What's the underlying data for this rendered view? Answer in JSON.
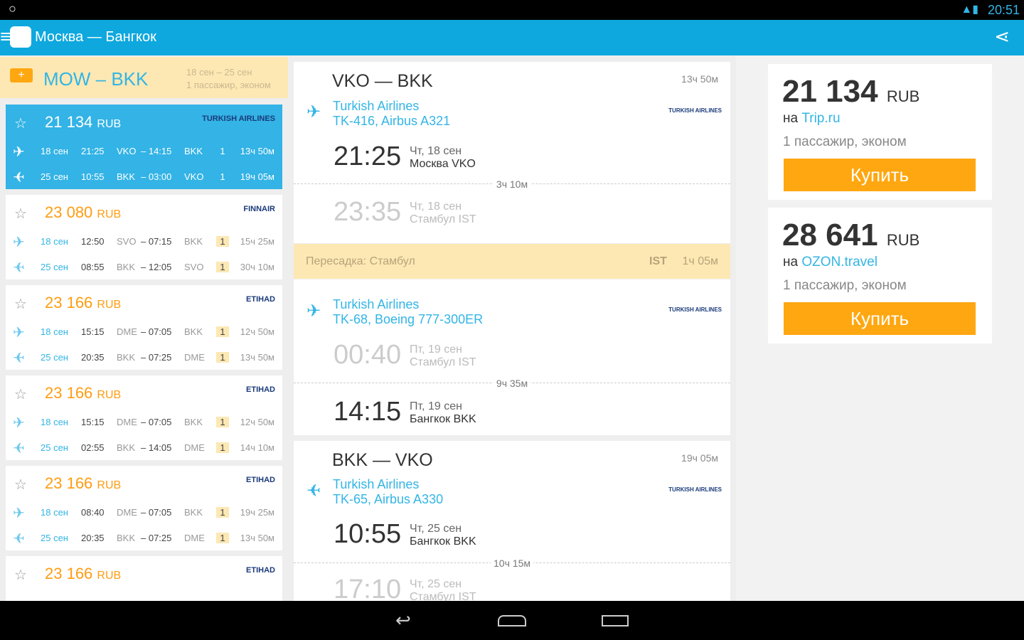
{
  "status": {
    "time": "20:51"
  },
  "appbar": {
    "title": "Москва — Бангкок",
    "icons": [
      "menu-icon",
      "app-logo",
      "share-icon"
    ]
  },
  "search": {
    "route": "MOW – BKK",
    "dates": "18 сен – 25 сен",
    "pax": "1 пассажир, эконом"
  },
  "results": [
    {
      "price": "21 134",
      "cur": "RUB",
      "airline": "TURKISH AIRLINES",
      "selected": true,
      "segs": [
        [
          "18 сен",
          "21:25",
          "VKO",
          "– 14:15",
          "BKK",
          "1",
          "13ч 50м"
        ],
        [
          "25 сен",
          "10:55",
          "BKK",
          "– 03:00",
          "VKO",
          "1",
          "19ч 05м"
        ]
      ]
    },
    {
      "price": "23 080",
      "cur": "RUB",
      "airline": "FINNAIR",
      "segs": [
        [
          "18 сен",
          "12:50",
          "SVO",
          "– 07:15",
          "BKK",
          "1",
          "15ч 25м"
        ],
        [
          "25 сен",
          "08:55",
          "BKK",
          "– 12:05",
          "SVO",
          "1",
          "30ч 10м"
        ]
      ]
    },
    {
      "price": "23 166",
      "cur": "RUB",
      "airline": "ETIHAD",
      "segs": [
        [
          "18 сен",
          "15:15",
          "DME",
          "– 07:05",
          "BKK",
          "1",
          "12ч 50м"
        ],
        [
          "25 сен",
          "20:35",
          "BKK",
          "– 07:25",
          "DME",
          "1",
          "13ч 50м"
        ]
      ]
    },
    {
      "price": "23 166",
      "cur": "RUB",
      "airline": "ETIHAD",
      "segs": [
        [
          "18 сен",
          "15:15",
          "DME",
          "– 07:05",
          "BKK",
          "1",
          "12ч 50м"
        ],
        [
          "25 сен",
          "02:55",
          "BKK",
          "– 14:05",
          "DME",
          "1",
          "14ч 10м"
        ]
      ]
    },
    {
      "price": "23 166",
      "cur": "RUB",
      "airline": "ETIHAD",
      "segs": [
        [
          "18 сен",
          "08:40",
          "DME",
          "– 07:05",
          "BKK",
          "1",
          "19ч 25м"
        ],
        [
          "25 сен",
          "20:35",
          "BKK",
          "– 07:25",
          "DME",
          "1",
          "13ч 50м"
        ]
      ]
    },
    {
      "price": "23 166",
      "cur": "RUB",
      "airline": "ETIHAD",
      "segs": []
    }
  ],
  "detail": {
    "out": {
      "route": "VKO — BKK",
      "duration": "13ч 50м",
      "f1": {
        "airline": "Turkish Airlines",
        "flight": "TK-416, Airbus A321",
        "logo": "TURKISH AIRLINES",
        "dep_time": "21:25",
        "dep_date": "Чт, 18 сен",
        "dep_place": "Москва VKO",
        "flight_dur": "3ч 10м",
        "arr_time": "23:35",
        "arr_date": "Чт, 18 сен",
        "arr_place": "Стамбул IST"
      },
      "transfer": {
        "label": "Пересадка: Стамбул",
        "code": "IST",
        "wait": "1ч 05м"
      },
      "f2": {
        "airline": "Turkish Airlines",
        "flight": "TK-68, Boeing 777-300ER",
        "logo": "TURKISH AIRLINES",
        "dep_time": "00:40",
        "dep_date": "Пт, 19 сен",
        "dep_place": "Стамбул IST",
        "flight_dur": "9ч 35м",
        "arr_time": "14:15",
        "arr_date": "Пт, 19 сен",
        "arr_place": "Бангкок BKK"
      }
    },
    "ret": {
      "route": "BKK — VKO",
      "duration": "19ч 05м",
      "f1": {
        "airline": "Turkish Airlines",
        "flight": "TK-65, Airbus A330",
        "logo": "TURKISH AIRLINES",
        "dep_time": "10:55",
        "dep_date": "Чт, 25 сен",
        "dep_place": "Бангкок BKK",
        "flight_dur": "10ч 15м",
        "arr_time": "17:10",
        "arr_date": "Чт, 25 сен",
        "arr_place": "Стамбул IST"
      }
    }
  },
  "offers": [
    {
      "price": "21 134",
      "cur": "RUB",
      "prefix": "на",
      "site": "Trip.ru",
      "cls": "1 пассажир, эконом",
      "buy": "Купить"
    },
    {
      "price": "28 641",
      "cur": "RUB",
      "prefix": "на",
      "site": "OZON.travel",
      "cls": "1 пассажир, эконом",
      "buy": "Купить"
    }
  ],
  "colors": {
    "accent": "#0ea8de",
    "orange": "#ffa711",
    "highlight": "#fde8b4"
  }
}
